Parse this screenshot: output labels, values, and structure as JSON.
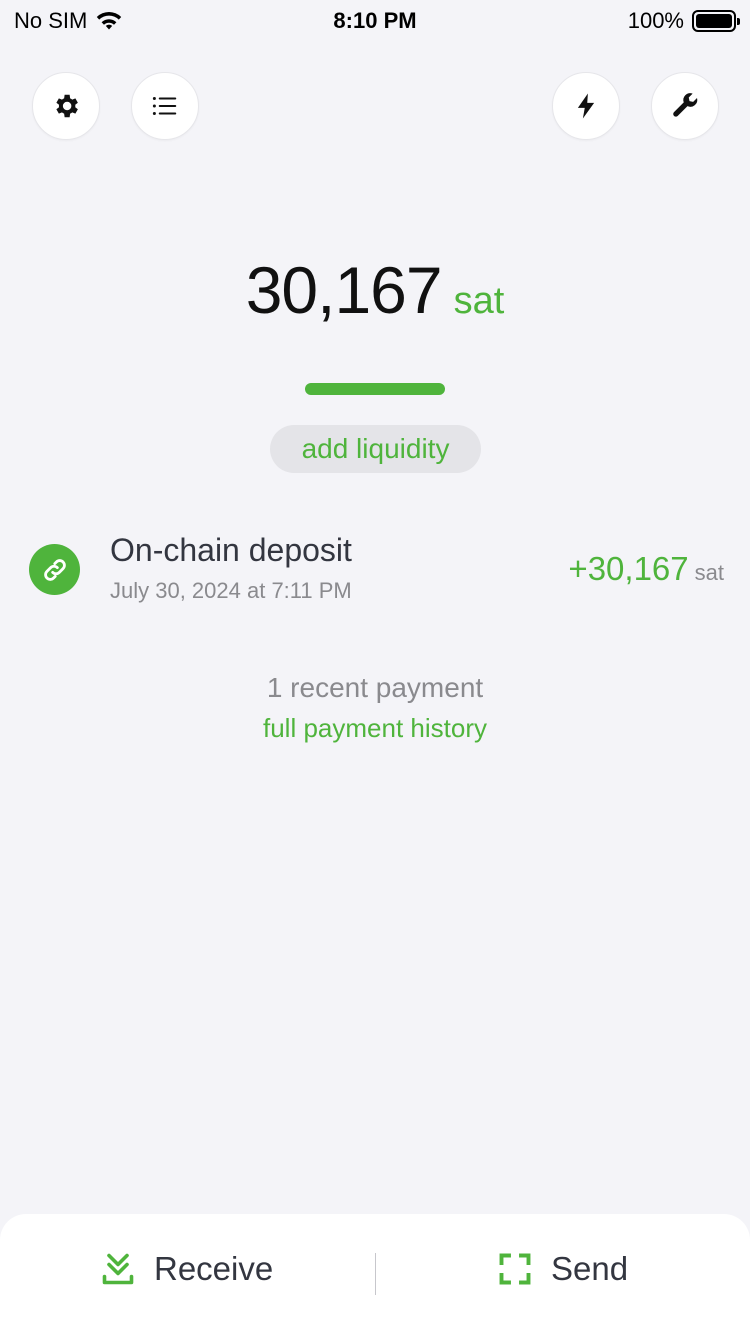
{
  "status_bar": {
    "carrier": "No SIM",
    "time": "8:10 PM",
    "battery": "100%",
    "battery_level": 1.0
  },
  "toolbar": {
    "settings_icon": "gear-icon",
    "transactions_icon": "list-icon",
    "lightning_icon": "lightning-icon",
    "tools_icon": "wrench-icon"
  },
  "balance": {
    "amount": "30,167",
    "unit": "sat"
  },
  "liquidity": {
    "label": "add liquidity"
  },
  "payments": [
    {
      "title": "On-chain deposit",
      "date": "July 30, 2024 at 7:11 PM",
      "amount": "+30,167",
      "unit": "sat",
      "icon": "link-icon"
    }
  ],
  "recent": {
    "count_label": "1 recent payment",
    "history_link": "full payment history"
  },
  "bottom_bar": {
    "receive_label": "Receive",
    "send_label": "Send"
  },
  "colors": {
    "accent": "#4fb43c",
    "background": "#f4f4f8",
    "secondary_text": "#8a8a8e"
  }
}
